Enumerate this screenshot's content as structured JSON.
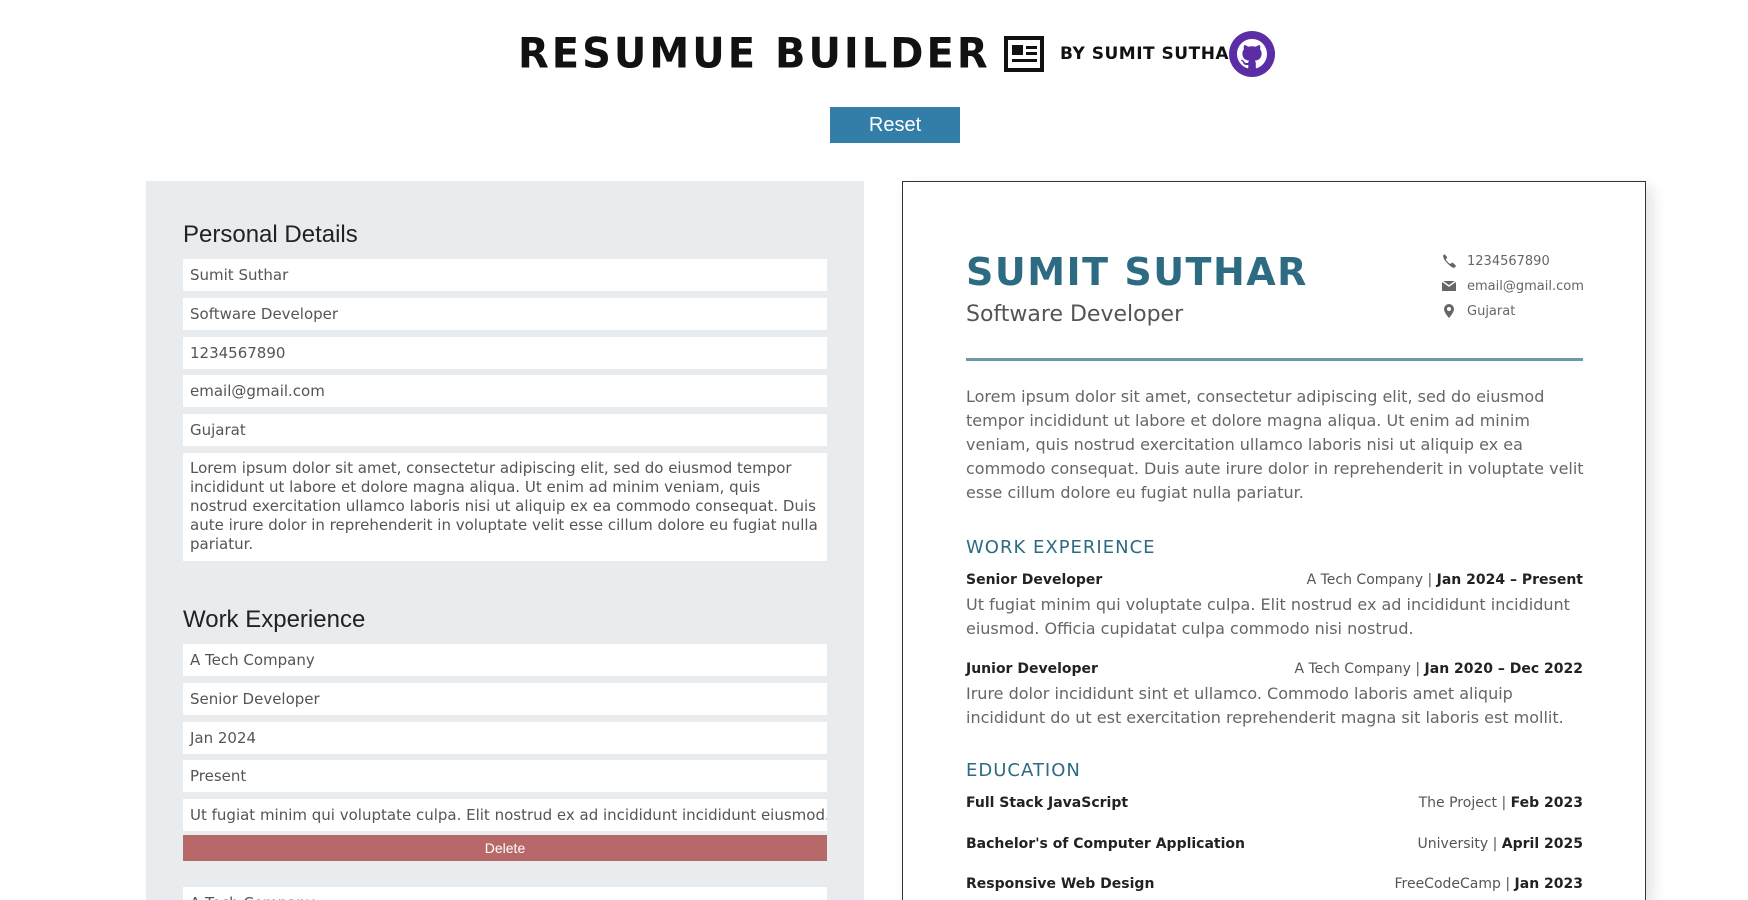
{
  "header": {
    "title": "RESUMUE BUILDER",
    "byline": "BY SUMIT SUTHAR",
    "icons": [
      "newspaper-icon",
      "github-icon"
    ],
    "reset_label": "Reset",
    "colors": {
      "reset": "#337ea8",
      "github": "#5b2ea6"
    }
  },
  "editor": {
    "personal_heading": "Personal Details",
    "name": "Sumit Suthar",
    "job_title": "Software Developer",
    "phone": "1234567890",
    "email": "email@gmail.com",
    "location": "Gujarat",
    "summary": "Lorem ipsum dolor sit amet, consectetur adipiscing elit, sed do eiusmod tempor incididunt ut labore et dolore magna aliqua. Ut enim ad minim veniam, quis nostrud exercitation ullamco laboris nisi ut aliquip ex ea commodo consequat. Duis aute irure dolor in reprehenderit in voluptate velit esse cillum dolore eu fugiat nulla pariatur.",
    "work_heading": "Work Experience",
    "work_entry": {
      "company": "A Tech Company",
      "role": "Senior Developer",
      "start": "Jan 2024",
      "end": "Present",
      "description": "Ut fugiat minim qui voluptate culpa. Elit nostrud ex ad incididunt incididunt eiusmod. Officia cupidatat culpa commodo nisi nostrud.",
      "delete_label": "Delete"
    },
    "next_entry_company": "A Tech Company",
    "colors": {
      "panel": "#e8ecee",
      "delete": "#b7696a"
    }
  },
  "resume": {
    "name": "SUMIT SUTHAR",
    "title": "Software Developer",
    "phone": "1234567890",
    "email": "email@gmail.com",
    "location": "Gujarat",
    "summary": "Lorem ipsum dolor sit amet, consectetur adipiscing elit, sed do eiusmod tempor incididunt ut labore et dolore magna aliqua. Ut enim ad minim veniam, quis nostrud exercitation ullamco laboris nisi ut aliquip ex ea commodo consequat. Duis aute irure dolor in reprehenderit in voluptate velit esse cillum dolore eu fugiat nulla pariatur.",
    "work_heading": "WORK EXPERIENCE",
    "work": [
      {
        "role": "Senior Developer",
        "company": "A Tech Company",
        "dates": "Jan 2024 – Present",
        "description": "Ut fugiat minim qui voluptate culpa. Elit nostrud ex ad incididunt incididunt eiusmod. Officia cupidatat culpa commodo nisi nostrud."
      },
      {
        "role": "Junior Developer",
        "company": "A Tech Company",
        "dates": "Jan 2020 – Dec 2022",
        "description": "Irure dolor incididunt sint et ullamco. Commodo laboris amet aliquip incididunt do ut est exercitation reprehenderit magna sit laboris est mollit."
      }
    ],
    "education_heading": "EDUCATION",
    "education": [
      {
        "degree": "Full Stack JavaScript",
        "school": "The Project",
        "date": "Feb 2023"
      },
      {
        "degree": "Bachelor's of Computer Application",
        "school": "University",
        "date": "April 2025"
      },
      {
        "degree": "Responsive Web Design",
        "school": "FreeCodeCamp",
        "date": "Jan 2023"
      }
    ],
    "colors": {
      "accent": "#2d6b82",
      "rule": "#6a9aaa"
    }
  }
}
